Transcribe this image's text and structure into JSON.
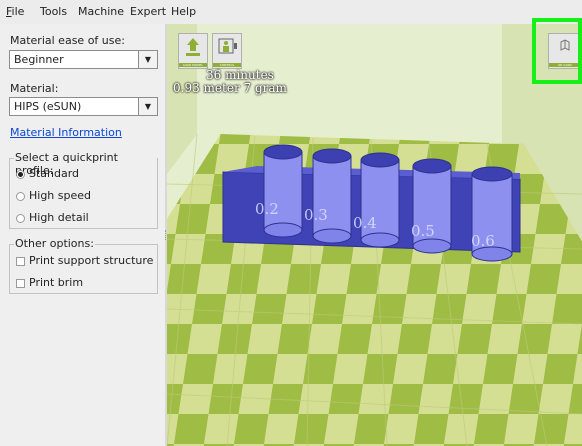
{
  "menubar": {
    "items": [
      {
        "label": "File",
        "accel": "F"
      },
      {
        "label": "Tools"
      },
      {
        "label": "Machine"
      },
      {
        "label": "Expert"
      },
      {
        "label": "Help"
      }
    ]
  },
  "sidebar": {
    "ease_label": "Material ease of use:",
    "ease_value": "Beginner",
    "material_label": "Material:",
    "material_value": "HIPS (eSUN)",
    "material_info_link": "Material Information",
    "quickprint": {
      "title": "Select a quickprint profile:",
      "options": [
        {
          "label": "Standard",
          "checked": true
        },
        {
          "label": "High speed",
          "checked": false
        },
        {
          "label": "High detail",
          "checked": false
        }
      ]
    },
    "other": {
      "title": "Other options:",
      "options": [
        {
          "label": "Print support structure",
          "checked": false
        },
        {
          "label": "Print brim",
          "checked": false
        }
      ]
    }
  },
  "viewport": {
    "toolbar": {
      "load_label": "LOAD MODEL",
      "control_label": "CONTROL",
      "sd_label": "SD CARD"
    },
    "estimate": {
      "time": "36 minutes",
      "material": "0.93 meter 7 gram"
    },
    "model_labels": [
      "0.2",
      "0.3",
      "0.4",
      "0.5",
      "0.6"
    ],
    "colors": {
      "model": "#4b4fc0",
      "highlight": "#17f017",
      "floor_light": "#d4df94",
      "floor_dark": "#9fbc45"
    }
  }
}
